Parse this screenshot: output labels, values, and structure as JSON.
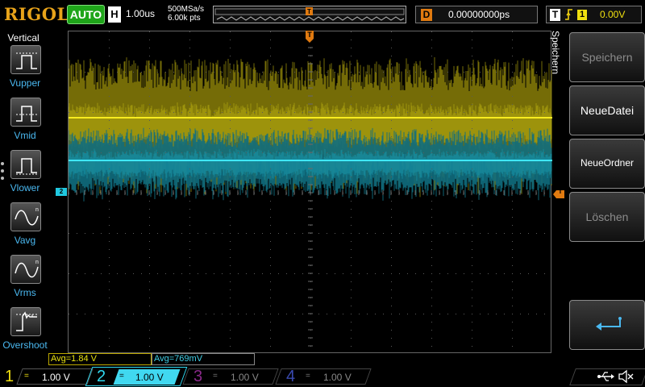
{
  "top": {
    "brand": "RIGOL",
    "run_mode": "AUTO",
    "horizontal_tag": "H",
    "timebase": "1.00us",
    "sample_rate": "500MSa/s",
    "memory_depth": "6.00k pts",
    "trigger_marker": "T",
    "delay_tag": "D",
    "delay_value": "0.00000000ps",
    "trigger_tag": "T",
    "trigger_edge_icon": "rising-edge-icon",
    "trigger_source": "1",
    "trigger_level": "0.00V"
  },
  "left_menu": {
    "title": "Vertical",
    "items": [
      {
        "label": "Vupper",
        "icon": "vupper-icon"
      },
      {
        "label": "Vmid",
        "icon": "vmid-icon"
      },
      {
        "label": "Vlower",
        "icon": "vlower-icon"
      },
      {
        "label": "Vavg",
        "icon": "vavg-icon"
      },
      {
        "label": "Vrms",
        "icon": "vrms-icon"
      },
      {
        "label": "Overshoot",
        "icon": "overshoot-icon"
      }
    ]
  },
  "screen": {
    "ch2_marker": "2",
    "trigger_top_marker": "T",
    "trigger_level_marker": "T"
  },
  "measurements": {
    "ch1": "Avg=1.84 V",
    "ch2": "Avg=769mV"
  },
  "right_menu": {
    "title": "Speichern",
    "buttons": [
      {
        "label": "Speichern",
        "enabled": false
      },
      {
        "label": "NeueDatei",
        "enabled": true
      },
      {
        "label": "NeueOrdner",
        "enabled": true
      },
      {
        "label": "Löschen",
        "enabled": false
      }
    ],
    "back_icon": "return-arrow-icon"
  },
  "channels": [
    {
      "num": "1",
      "coupling": "=",
      "scale": "1.00 V",
      "color": "#f0e010",
      "active": true
    },
    {
      "num": "2",
      "coupling": "=",
      "scale": "1.00 V",
      "color": "#30d8f0",
      "active": true
    },
    {
      "num": "3",
      "coupling": "=",
      "scale": "1.00 V",
      "color": "#8a2a8a",
      "active": false
    },
    {
      "num": "4",
      "coupling": "=",
      "scale": "1.00 V",
      "color": "#3a4ab0",
      "active": false
    }
  ],
  "status": {
    "usb_icon": "usb-icon",
    "sound_icon": "speaker-muted-icon"
  }
}
